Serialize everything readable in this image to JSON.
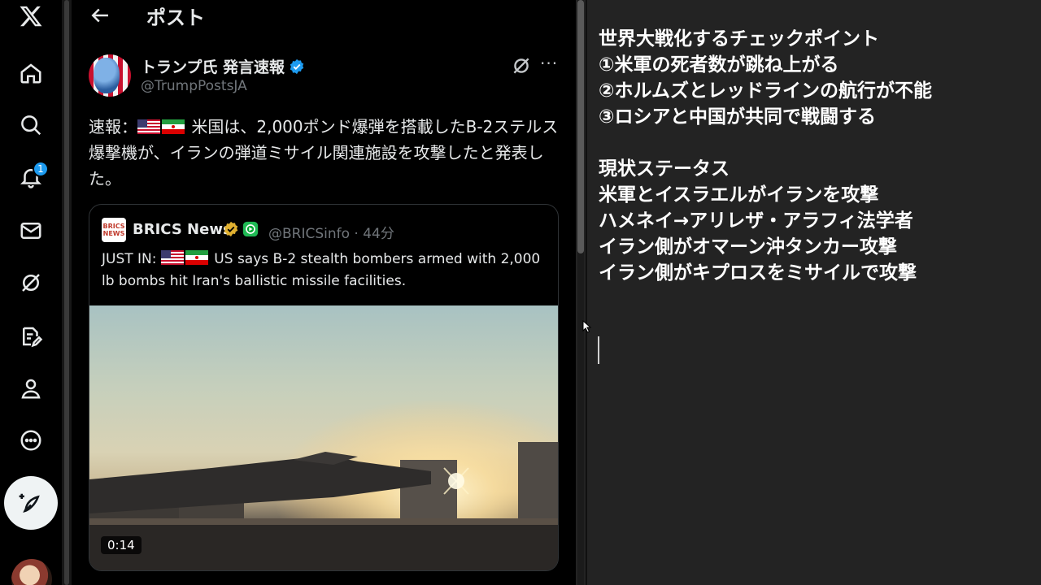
{
  "header": {
    "title": "ポスト"
  },
  "rail": {
    "notification_count": "1",
    "items": [
      "x-logo",
      "home",
      "explore",
      "notifications",
      "messages",
      "grok",
      "compose-draft",
      "profile",
      "more"
    ]
  },
  "post": {
    "author": "トランプ氏 発言速報",
    "handle": "@TrumpPostsJA",
    "text_prefix": "速報：",
    "text_body": " 米国は、2,000ポンド爆弾を搭載したB-2ステルス爆撃機が、イランの弾道ミサイル関連施設を攻撃したと発表した。"
  },
  "quote": {
    "logo_top": "BRICS",
    "logo_bottom": "NEWS",
    "name": "BRICS News",
    "meta": "@BRICSinfo · 44分",
    "text_prefix": "JUST IN: ",
    "text_body": " US says B-2 stealth bombers armed with 2,000 lb bombs hit Iran's ballistic missile facilities.",
    "video_duration": "0:14"
  },
  "notes": {
    "lines": [
      "世界大戦化するチェックポイント",
      "①米軍の死者数が跳ね上がる",
      "②ホルムズとレッドラインの航行が不能",
      "③ロシアと中国が共同で戦闘する",
      "",
      "現状ステータス",
      "米軍とイスラエルがイランを攻撃",
      "ハメネイ→アリレザ・アラフィ法学者",
      "イラン側がオマーン沖タンカー攻撃",
      "イラン側がキプロスをミサイルで攻撃"
    ]
  },
  "colors": {
    "accent": "#1d9bf0",
    "gold_badge": "#e0b030",
    "green_badge": "#1fb954",
    "panel_bg": "#232323"
  }
}
